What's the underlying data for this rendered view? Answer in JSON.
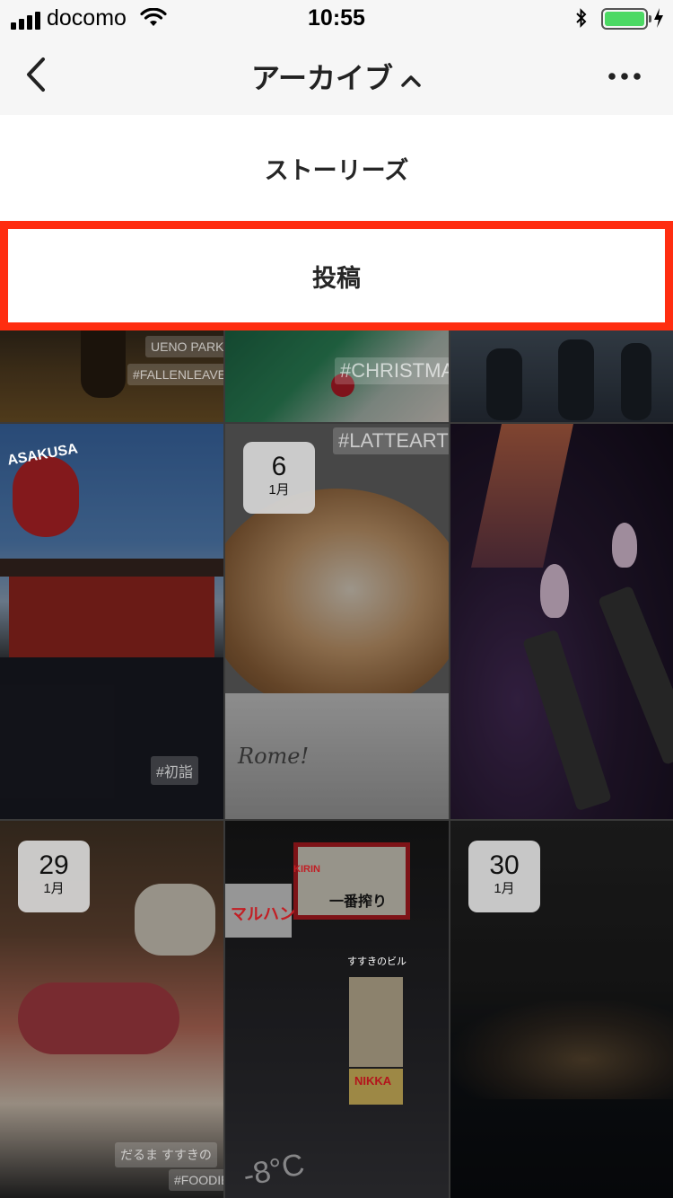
{
  "status_bar": {
    "carrier": "docomo",
    "time": "10:55"
  },
  "nav": {
    "title": "アーカイブ"
  },
  "menu": {
    "stories_label": "ストーリーズ",
    "posts_label": "投稿"
  },
  "grid": {
    "row0": {
      "tag_ueno": "UENO PARK",
      "tag_fallen": "#FALLENLEAVES",
      "tag_christmas": "#CHRISTMAS"
    },
    "row1": {
      "badge_day": "6",
      "badge_month": "1月",
      "tag_latte": "#LATTEART",
      "tag_hatsumode": "#初詣",
      "sign_asakusa": "ASAKUSA",
      "cup_text": "Rome!"
    },
    "row2": {
      "badge1_day": "29",
      "badge1_month": "1月",
      "badge2_day": "30",
      "badge2_month": "1月",
      "tag_daruma": "だるま すすきの",
      "tag_foodie": "#FOODIE",
      "sign_kirin": "KIRIN",
      "sign_ichiban": "一番搾り",
      "sign_susukino": "すすきのビル",
      "sign_maruhan": "マルハン",
      "sign_nikka": "NIKKA",
      "temp_sticker": "-8°C"
    }
  },
  "colors": {
    "highlight": "#ff2d10",
    "battery": "#4cd964"
  }
}
